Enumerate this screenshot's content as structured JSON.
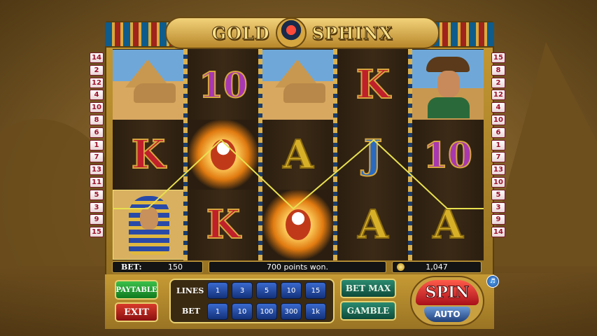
{
  "game": {
    "title_left": "GOLD",
    "title_right": "SPHINX",
    "scarab_icon": "scarab-icon"
  },
  "line_numbers": {
    "left": [
      "14",
      "2",
      "12",
      "4",
      "10",
      "8",
      "6",
      "1",
      "7",
      "13",
      "11",
      "5",
      "3",
      "9",
      "15"
    ],
    "right": [
      "15",
      "8",
      "2",
      "12",
      "4",
      "10",
      "6",
      "1",
      "7",
      "13",
      "10",
      "5",
      "3",
      "9",
      "14"
    ]
  },
  "reels": [
    [
      {
        "symbol": "sphinx",
        "icon": "sphinx-pyramid-icon"
      },
      {
        "symbol": "K",
        "label": "K"
      },
      {
        "symbol": "pharaoh",
        "icon": "pharaoh-icon"
      }
    ],
    [
      {
        "symbol": "10",
        "label": "10"
      },
      {
        "symbol": "scarab",
        "icon": "scarab-wild-icon"
      },
      {
        "symbol": "K",
        "label": "K"
      }
    ],
    [
      {
        "symbol": "sphinx",
        "icon": "sphinx-pyramid-icon"
      },
      {
        "symbol": "A",
        "label": "A"
      },
      {
        "symbol": "scarab",
        "icon": "scarab-wild-icon"
      }
    ],
    [
      {
        "symbol": "K",
        "label": "K"
      },
      {
        "symbol": "J",
        "label": "J"
      },
      {
        "symbol": "A",
        "label": "A"
      }
    ],
    [
      {
        "symbol": "explorer",
        "icon": "explorer-icon"
      },
      {
        "symbol": "10",
        "label": "10"
      },
      {
        "symbol": "A",
        "label": "A"
      }
    ]
  ],
  "info": {
    "bet_label": "BET:",
    "bet_value": "150",
    "message": "700 points won.",
    "credits": "1,047"
  },
  "controls": {
    "paytable": "PAYTABLE",
    "exit": "EXIT",
    "lines_label": "LINES",
    "lines_options": [
      "1",
      "3",
      "5",
      "10",
      "15"
    ],
    "bet_label": "BET",
    "bet_options": [
      "1",
      "10",
      "100",
      "300",
      "1k"
    ],
    "bet_max": "BET MAX",
    "gamble": "GAMBLE",
    "spin": "SPIN",
    "auto": "AUTO",
    "sound_icon": "speaker-icon"
  },
  "colors": {
    "frame_gold": "#c69a34",
    "payline": "#e8e050",
    "chip_blue": "#2a56b8"
  }
}
